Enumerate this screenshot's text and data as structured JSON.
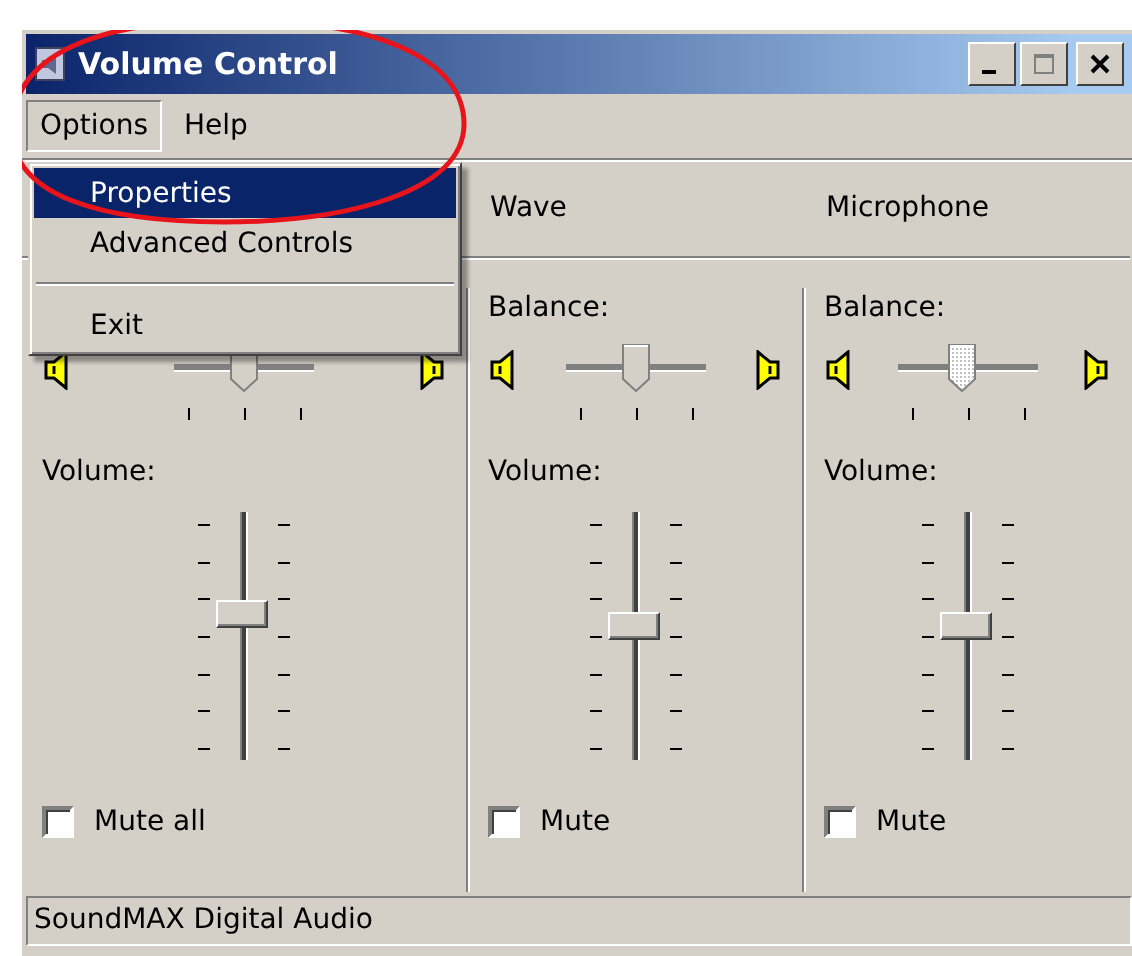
{
  "window": {
    "title": "Volume Control"
  },
  "menu_bar": [
    {
      "label": "Options",
      "selected": true
    },
    {
      "label": "Help",
      "selected": false
    }
  ],
  "dropdown": [
    {
      "kind": "item",
      "label": "Properties",
      "selected": true
    },
    {
      "kind": "item",
      "label": "Advanced Controls",
      "selected": false
    },
    {
      "kind": "separator"
    },
    {
      "kind": "item",
      "label": "Exit",
      "selected": false
    }
  ],
  "channels": [
    {
      "balance": {
        "level": 0.5,
        "focused": false
      },
      "volume": {
        "label": "Volume:",
        "level": 0.6
      },
      "mute": {
        "label": "Mute all",
        "checked": false
      }
    },
    {
      "name": "Wave",
      "balance": {
        "label": "Balance:",
        "level": 0.5,
        "focused": false
      },
      "volume": {
        "label": "Volume:",
        "level": 0.55
      },
      "mute": {
        "label": "Mute",
        "checked": false
      }
    },
    {
      "name": "Microphone",
      "balance": {
        "label": "Balance:",
        "level": 0.45,
        "focused": true
      },
      "volume": {
        "label": "Volume:",
        "level": 0.55
      },
      "mute": {
        "label": "Mute",
        "checked": false
      }
    }
  ],
  "status_bar": "SoundMAX Digital Audio"
}
